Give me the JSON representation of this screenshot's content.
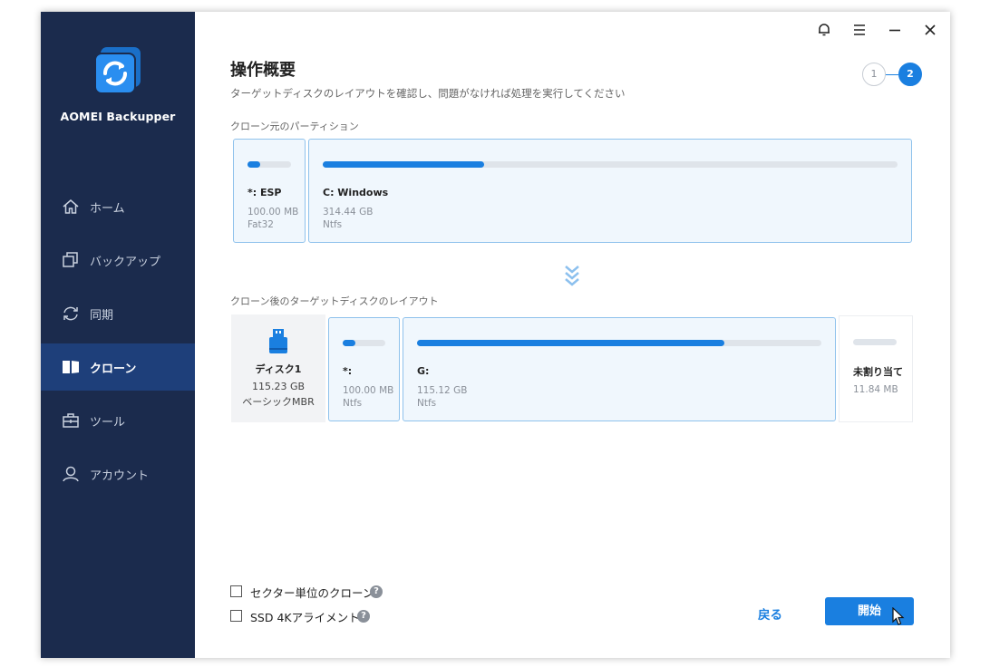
{
  "app": {
    "name": "AOMEI Backupper"
  },
  "sidebar": {
    "items": [
      {
        "label": "ホーム",
        "icon": "home-icon",
        "active": false
      },
      {
        "label": "バックアップ",
        "icon": "backup-icon",
        "active": false
      },
      {
        "label": "同期",
        "icon": "sync-icon",
        "active": false
      },
      {
        "label": "クローン",
        "icon": "clone-icon",
        "active": true
      },
      {
        "label": "ツール",
        "icon": "tools-icon",
        "active": false
      },
      {
        "label": "アカウント",
        "icon": "account-icon",
        "active": false
      }
    ]
  },
  "titlebar": {
    "buttons": [
      "bell-icon",
      "menu-icon",
      "minimize-icon",
      "close-icon"
    ]
  },
  "header": {
    "title": "操作概要",
    "subtitle": "ターゲットディスクのレイアウトを確認し、問題がなければ処理を実行してください",
    "steps": [
      "1",
      "2"
    ],
    "current_step": 2
  },
  "source": {
    "label": "クローン元のパーティション",
    "partitions": [
      {
        "name": "*: ESP",
        "size": "100.00 MB",
        "fs": "Fat32",
        "usage": 0.3
      },
      {
        "name": "C: Windows",
        "size": "314.44 GB",
        "fs": "Ntfs",
        "usage": 0.28
      }
    ]
  },
  "target": {
    "label": "クローン後のターゲットディスクのレイアウト",
    "disk": {
      "name": "ディスク1",
      "size": "115.23 GB",
      "type": "ベーシックMBR"
    },
    "partitions": [
      {
        "name": "*:",
        "size": "100.00 MB",
        "fs": "Ntfs",
        "usage": 0.3
      },
      {
        "name": "G:",
        "size": "115.12 GB",
        "fs": "Ntfs",
        "usage": 0.76
      }
    ],
    "unallocated": {
      "name": "未割り当て",
      "size": "11.84 MB"
    }
  },
  "options": [
    {
      "label": "セクター単位のクローン",
      "checked": false
    },
    {
      "label": "SSD 4Kアライメント",
      "checked": false
    }
  ],
  "footer": {
    "back_label": "戻る",
    "start_label": "開始"
  },
  "colors": {
    "sidebar_bg": "#1b2b4d",
    "sidebar_active": "#1e3f7a",
    "accent": "#1a7fe0"
  }
}
